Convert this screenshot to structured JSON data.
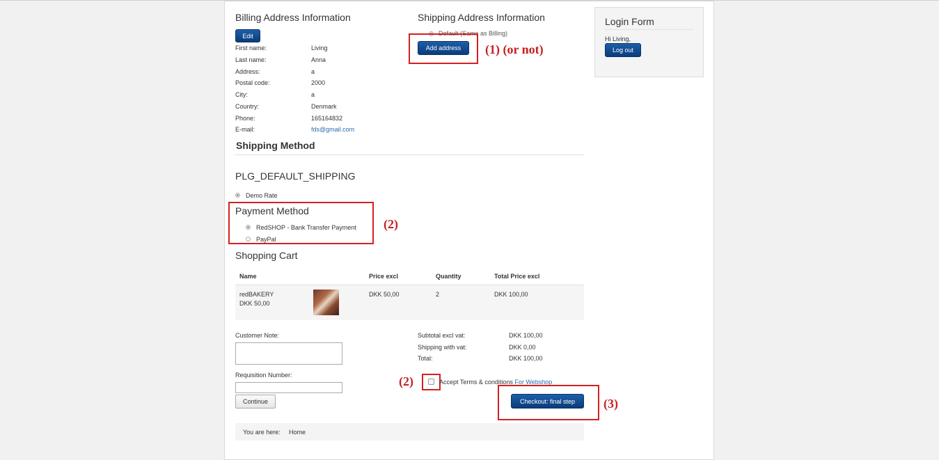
{
  "billing": {
    "title": "Billing Address Information",
    "edit_label": "Edit",
    "fields": [
      {
        "label": "First name:",
        "value": "Living"
      },
      {
        "label": "Last name:",
        "value": "Anna"
      },
      {
        "label": "Address:",
        "value": "a"
      },
      {
        "label": "Postal code:",
        "value": "2000"
      },
      {
        "label": "City:",
        "value": "a"
      },
      {
        "label": "Country:",
        "value": "Denmark"
      },
      {
        "label": "Phone:",
        "value": "165164832"
      },
      {
        "label": "E-mail:",
        "value": "fds@gmail.com"
      }
    ]
  },
  "shipping_address": {
    "title": "Shipping Address Information",
    "default_option": "Default (Same as Billing)",
    "add_label": "Add address"
  },
  "shipping_method": {
    "title": "Shipping Method",
    "plugin": "PLG_DEFAULT_SHIPPING",
    "rate": "Demo Rate"
  },
  "payment": {
    "title": "Payment Method",
    "options": [
      "RedSHOP - Bank Transfer Payment",
      "PayPal"
    ]
  },
  "cart": {
    "title": "Shopping Cart",
    "headers": [
      "Name",
      "Price excl",
      "Quantity",
      "Total Price excl"
    ],
    "item": {
      "name": "redBAKERY",
      "price_under": "DKK 50,00",
      "price": "DKK 50,00",
      "quantity": "2",
      "total": "DKK 100,00"
    }
  },
  "totals": [
    {
      "label": "Subtotal excl vat:",
      "value": "DKK 100,00"
    },
    {
      "label": "Shipping with vat:",
      "value": "DKK 0,00"
    },
    {
      "label": "Total:",
      "value": "DKK 100,00"
    }
  ],
  "customer_note_label": "Customer Note:",
  "requisition_label": "Requisition Number:",
  "continue_label": "Continue",
  "terms_text": "Accept Terms & conditions",
  "terms_link": "For Webshop",
  "checkout_label": "Checkout: final step",
  "breadcrumb": {
    "prefix": "You are here:",
    "home": "Home"
  },
  "login": {
    "title": "Login Form",
    "greeting": "Hi Living,",
    "logout_label": "Log out"
  },
  "annotations": {
    "a1": "(1) (or not)",
    "a2": "(2)",
    "a2b": "(2)",
    "a3": "(3)"
  },
  "colors": {
    "accent": "#0b3c7a",
    "link": "#2a6cb0",
    "annotation": "#d32020"
  }
}
